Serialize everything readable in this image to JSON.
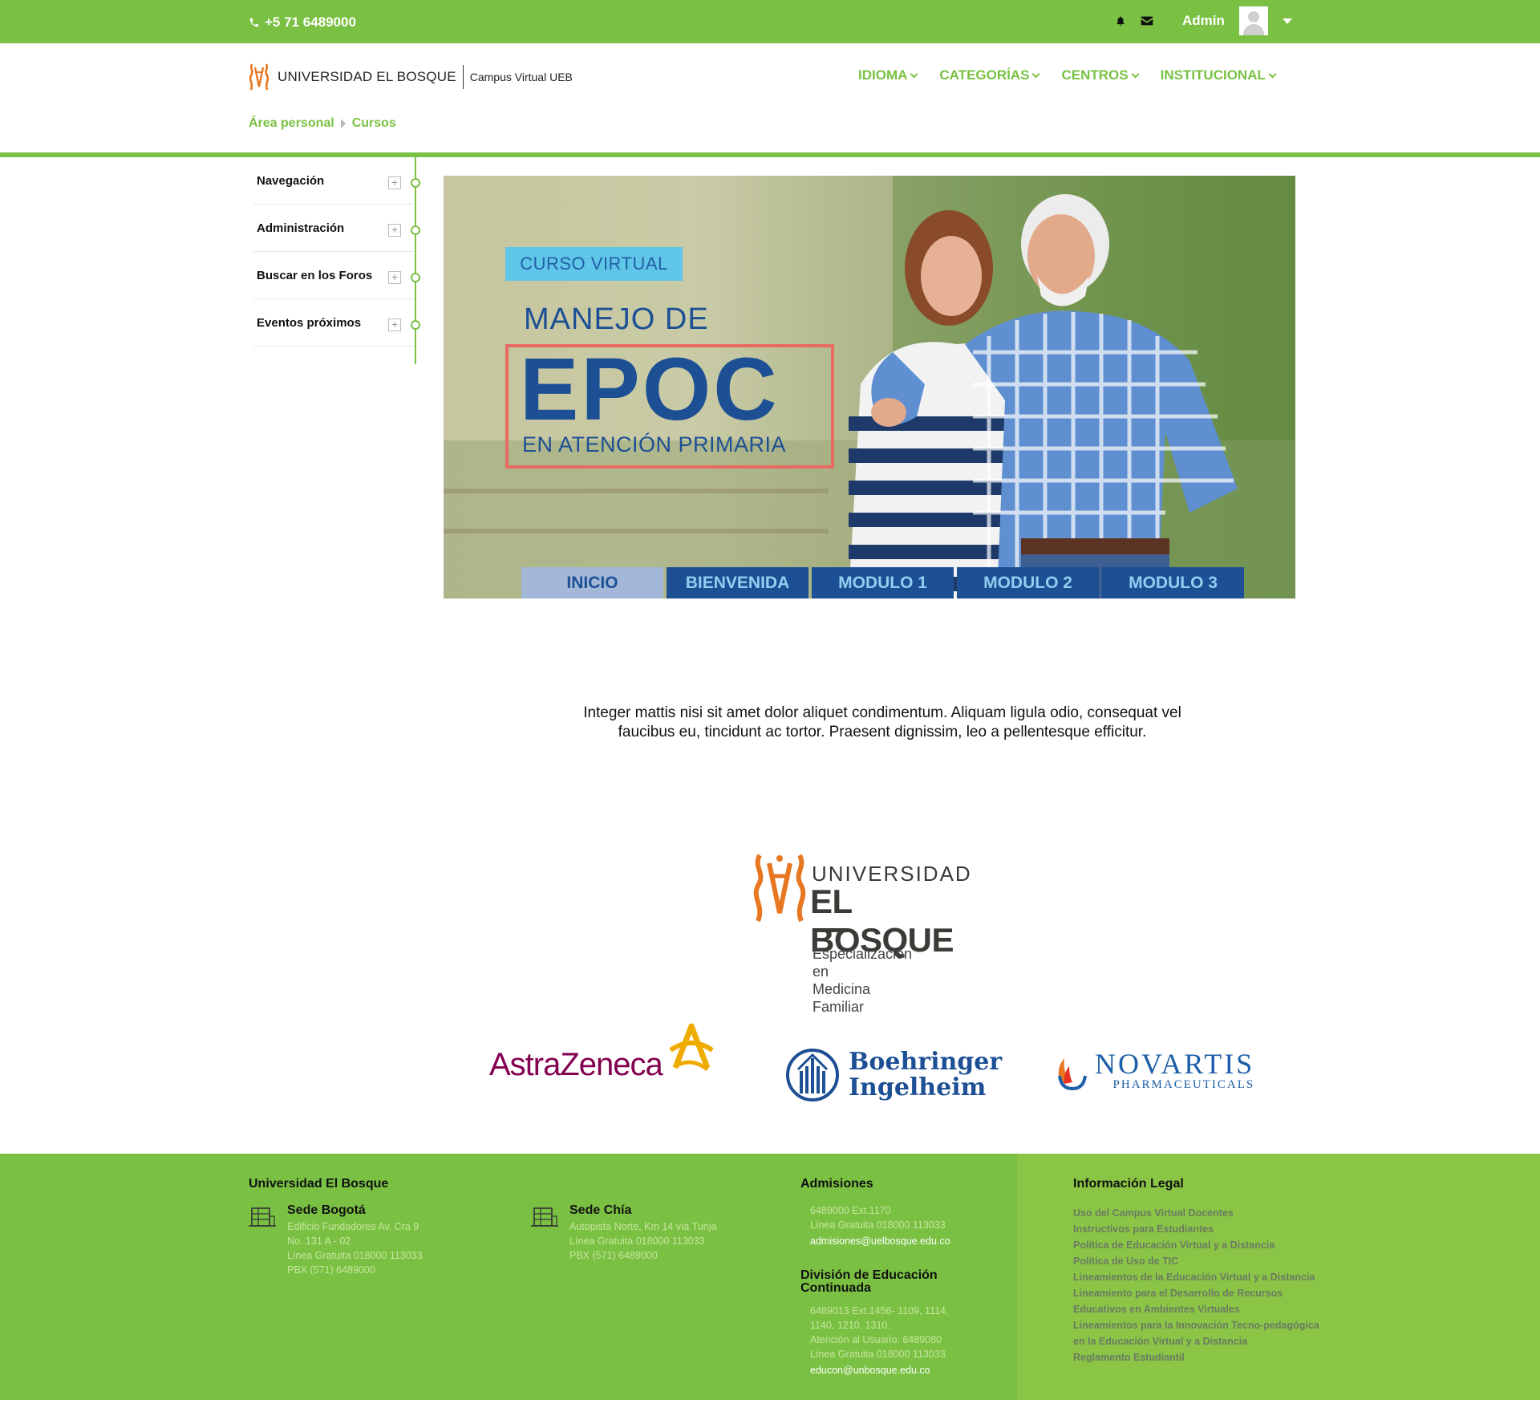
{
  "topbar": {
    "phone": "+5 71 6489000",
    "user_name": "Admin",
    "icons": [
      "phone-icon",
      "bell-icon",
      "envelope-icon",
      "avatar",
      "caret-down-icon"
    ]
  },
  "header": {
    "logo_university": "UNIVERSIDAD EL BOSQUE",
    "logo_campus": "Campus Virtual UEB",
    "nav": [
      "IDIOMA",
      "CATEGORÍAS",
      "CENTROS",
      "INSTITUCIONAL"
    ],
    "breadcrumb": [
      "Área personal",
      "Cursos"
    ]
  },
  "sidebar": {
    "items": [
      "Navegación",
      "Administración",
      "Buscar en los Foros",
      "Eventos próximos"
    ]
  },
  "banner": {
    "tag": "CURSO VIRTUAL",
    "title_line1": "MANEJO DE",
    "title_main": "EPOC",
    "title_sub": "EN ATENCIÓN PRIMARIA",
    "tabs": [
      "INICIO",
      "BIENVENIDA",
      "MODULO 1",
      "MODULO 2",
      "MODULO 3"
    ],
    "active_tab": "INICIO"
  },
  "intro_text": "Integer mattis nisi sit amet dolor aliquet condimentum. Aliquam ligula odio, consequat vel faucibus eu, tincidunt ac tortor. Praesent dignissim, leo a pellentesque efficitur.",
  "logo_block": {
    "line1": "UNIVERSIDAD",
    "line2": "EL BOSQUE",
    "spec1": "Especialización en",
    "spec2": "Medicina Familiar"
  },
  "sponsors": {
    "astrazeneca": "AstraZeneca",
    "boehringer_1": "Boehringer",
    "boehringer_2": "Ingelheim",
    "novartis": "NOVARTIS",
    "novartis_sub": "PHARMACEUTICALS"
  },
  "footer": {
    "col1_title": "Universidad El Bosque",
    "bogota": {
      "name": "Sede Bogotá",
      "lines": [
        "Edificio Fundadores Av. Cra 9",
        "No. 131 A - 02",
        "Línea Gratuita 018000 113033",
        "PBX (571) 6489000"
      ]
    },
    "chia": {
      "name": "Sede Chía",
      "lines": [
        "Autopista Norte, Km 14 vía Tunja",
        "Línea Gratuita 018000 113033",
        "PBX (571) 6489000"
      ]
    },
    "admisiones": {
      "title": "Admisiones",
      "lines": [
        "6489000 Ext.1170",
        "Línea Gratuita 018000 113033"
      ],
      "email": "admisiones@uelbosque.edu.co"
    },
    "continuada": {
      "title_1": "División de Educación",
      "title_2": "Continuada",
      "lines": [
        "6489013 Ext.1456- 1109, 1114,",
        "1140, 1210, 1310.",
        "Atención al Usuario: 6489080",
        "Línea Gratuita 018000 113033"
      ],
      "email": "educon@unbosque.edu.co"
    },
    "legal": {
      "title": "Información Legal",
      "links": [
        "Uso del Campus Virtual Docentes",
        "Instructivos para Estudiantes",
        "Política de Educación Virtual y a Distancia",
        "Política de Uso de TIC",
        "Lineamientos de la Educación Virtual y a Distancia",
        "Lineamiento para el Desarrollo de Recursos",
        "Educativos en Ambientes Virtuales",
        "Lineamientos para la Innovación Tecno-pedagógica",
        "en la Educación Virtual y a Distancia",
        "Reglamento Estudiantil"
      ]
    }
  },
  "colors": {
    "brand_green": "#7ac143",
    "navy": "#1d4f95",
    "sky": "#5fc6e8",
    "coral": "#e86a60",
    "bosque_orange": "#e87722"
  }
}
